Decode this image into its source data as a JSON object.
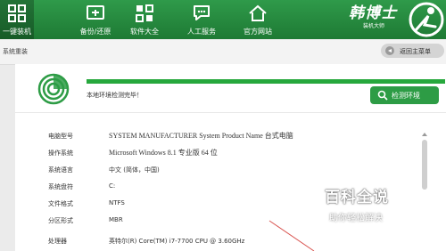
{
  "nav": {
    "items": [
      {
        "label": "一键装机",
        "icon": "grid-icon",
        "active": true
      },
      {
        "label": "备份/还原",
        "icon": "backup-restore-icon",
        "active": false
      },
      {
        "label": "软件大全",
        "icon": "software-icon",
        "active": false
      },
      {
        "label": "人工服务",
        "icon": "chat-icon",
        "active": false
      },
      {
        "label": "官方网站",
        "icon": "home-icon",
        "active": false
      }
    ],
    "logo_text": "韩博士",
    "logo_sub": "装机大师"
  },
  "breadcrumb": "系统重装",
  "back_button": "返回主菜单",
  "detect": {
    "progress_percent": 100,
    "status_text": "本地环境检测完毕！",
    "check_button": "检测环境"
  },
  "system_info": [
    {
      "key": "电脑型号",
      "value": "SYSTEM MANUFACTURER System Product Name 台式电脑"
    },
    {
      "key": "操作系统",
      "value": "Microsoft Windows 8.1 专业版 64 位"
    },
    {
      "key": "系统语言",
      "value": "中文 (简体，中国)"
    },
    {
      "key": "系统盘符",
      "value": "C:"
    },
    {
      "key": "文件格式",
      "value": "NTFS"
    },
    {
      "key": "分区形式",
      "value": "MBR"
    },
    {
      "key": "处理器",
      "value": "英特尔(R) Core(TM) i7-7700 CPU @ 3.60GHz"
    }
  ],
  "watermark": {
    "title": "百科全说",
    "subtitle": "助你轻松解决"
  },
  "colors": {
    "brand_green": "#1e7a34",
    "accent_green": "#27a83d",
    "annotation_arrow": "#d9534f"
  }
}
